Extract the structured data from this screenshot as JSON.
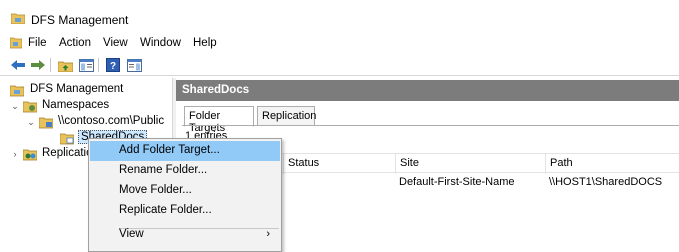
{
  "window": {
    "title": "DFS Management",
    "icon": "dfs-management-icon"
  },
  "menu": [
    "File",
    "Action",
    "View",
    "Window",
    "Help"
  ],
  "toolbar": {
    "buttons": [
      "back-icon",
      "forward-icon",
      "up-folder-icon",
      "show-hide-console-tree-icon",
      "help-icon",
      "show-hide-action-pane-icon"
    ]
  },
  "tree": {
    "root": "DFS Management",
    "namespaces": "Namespaces",
    "namespace": "\\\\contoso.com\\Public",
    "folder": "SharedDocs",
    "replication": "Replicatio"
  },
  "right_pane": {
    "header": "SharedDocs",
    "tabs": [
      "Folder Targets",
      "Replication"
    ],
    "entries_text": "1 entries",
    "columns": [
      "",
      "Status",
      "Site",
      "Path"
    ],
    "rows": [
      {
        "status": "",
        "site": "Default-First-Site-Name",
        "path": "\\\\HOST1\\SharedDOCS"
      }
    ]
  },
  "context_menu": {
    "items": [
      "Add Folder Target...",
      "Rename Folder...",
      "Move Folder...",
      "Replicate Folder..."
    ],
    "submenu_item": "View",
    "submenu_arrow": "›",
    "highlighted_index": 0
  },
  "colors": {
    "pane_header_bg": "#7c7c7c",
    "menu_highlight": "#91c9f7",
    "selection": "#cce8ff"
  }
}
